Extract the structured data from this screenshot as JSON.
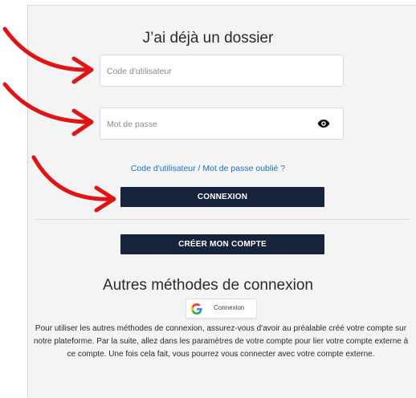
{
  "login": {
    "title": "J’ai déjà un dossier",
    "username_placeholder": "Code d'utilisateur",
    "password_placeholder": "Mot de passe",
    "forgot_link": "Code d'utilisateur / Mot de passe oublié ?",
    "connexion_label": "CONNEXION",
    "create_account_label": "CRÉER MON COMPTE"
  },
  "alt": {
    "title": "Autres méthodes de connexion",
    "google_label": "Connexion",
    "info_text": "Pour utiliser les autres méthodes de connexion, assurez-vous d'avoir au préalable créé votre compte sur notre plateforme. Par la suite, allez dans les paramètres de votre compte pour lier votre compte externe à ce compte. Une fois cela fait, vous pourrez vous connecter avec votre compte externe."
  },
  "icons": [
    "eye-icon",
    "google-icon",
    "red-arrow-icon"
  ],
  "colors": {
    "button": "#16233a",
    "link": "#1a73c9",
    "arrow": "#e01414",
    "panel": "#f4f4f4"
  }
}
